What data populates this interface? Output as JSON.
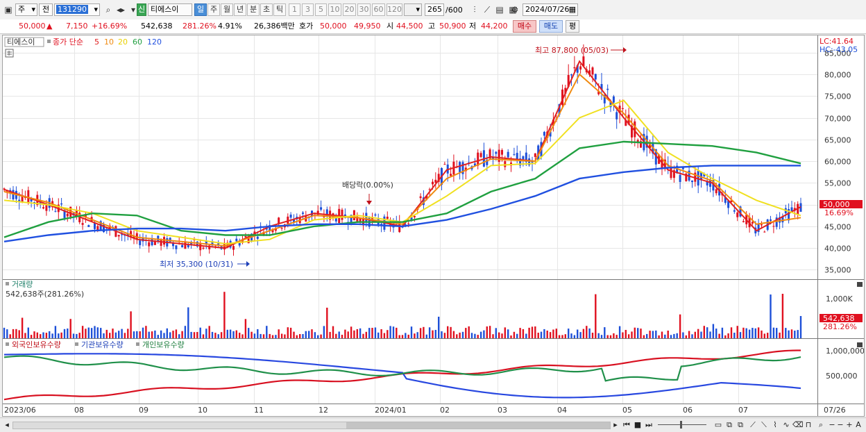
{
  "toolbar": {
    "interval_select": "주",
    "compare_label": "전",
    "stock_code": "131290",
    "badge": "신",
    "stock_name": "티에스이",
    "periods": [
      "일",
      "주",
      "월",
      "년",
      "분",
      "초",
      "틱"
    ],
    "selected_period": "일",
    "intervals": [
      "1",
      "3",
      "5",
      "10",
      "20",
      "30",
      "60",
      "120"
    ],
    "count": "265",
    "count_total": "/600",
    "date": "2024/07/26"
  },
  "quote": {
    "price": "50,000",
    "arrow": "▲",
    "change": "7,150",
    "change_pct": "+16.69%",
    "volume": "542,638",
    "volume_pct": "281.26%",
    "turnover": "4.91%",
    "amount": "26,386백만",
    "bid_label": "호가",
    "ask": "50,000",
    "bid": "49,950",
    "open_label": "시",
    "open": "44,500",
    "high_label": "고",
    "high": "50,900",
    "low_label": "저",
    "low": "44,200",
    "buy": "매수",
    "sell": "매도",
    "avg": "평"
  },
  "legend": {
    "name": "티에스이",
    "close_label": "종가 단순",
    "ma": [
      "5",
      "10",
      "20",
      "60",
      "120"
    ]
  },
  "annotations": {
    "high": "최고 87,800 (05/03)",
    "low": "최저 35,300 (10/31)",
    "dividend": "배당락(0.00%)",
    "lc": "LC:41.64",
    "hc": "HC:-43.05"
  },
  "price_axis": {
    "ticks": [
      "85,000",
      "80,000",
      "75,000",
      "70,000",
      "65,000",
      "60,000",
      "55,000",
      "50,000",
      "45,000",
      "40,000",
      "35,000"
    ],
    "current": "50,000",
    "current_pct": "16.69%"
  },
  "volume_panel": {
    "title": "거래량",
    "value": "542,638주(281.26%)",
    "tick": "1,000K",
    "current": "542,638",
    "current_pct": "281.26%"
  },
  "holdings_panel": {
    "foreign": "외국인보유수량",
    "inst": "기관보유수량",
    "indiv": "개인보유수량",
    "ticks": [
      "1,000,000",
      "500,000"
    ]
  },
  "date_axis": [
    "2023/06",
    "08",
    "09",
    "10",
    "11",
    "12",
    "2024/01",
    "02",
    "03",
    "04",
    "05",
    "06",
    "07",
    "07/26"
  ],
  "colors": {
    "up": "#e0101f",
    "down": "#1d4fd8",
    "ma5": "#e02020",
    "ma10": "#f08a10",
    "ma20": "#f0e020",
    "ma60": "#20a040",
    "ma120": "#2050e0"
  },
  "chart_data": {
    "type": "line",
    "price_range": [
      33000,
      88000
    ],
    "current_close": 50000,
    "high": {
      "value": 87800,
      "date": "05/03"
    },
    "low": {
      "value": 35300,
      "date": "10/31"
    },
    "x": [
      "2023/06",
      "08",
      "09",
      "10",
      "11",
      "12",
      "2024/01",
      "02",
      "03",
      "04",
      "05",
      "06",
      "07",
      "07/26"
    ],
    "series": [
      {
        "name": "5",
        "values": [
          53500,
          50000,
          46000,
          42000,
          41000,
          40000,
          45000,
          48000,
          47000,
          45000,
          58000,
          61000,
          60000,
          83000,
          70000,
          58000,
          55000,
          44000,
          49500
        ]
      },
      {
        "name": "10",
        "values": [
          53000,
          50500,
          46500,
          42500,
          41500,
          40500,
          44000,
          47500,
          47000,
          45500,
          56000,
          60500,
          60000,
          80000,
          71000,
          59000,
          55500,
          45500,
          47000
        ]
      },
      {
        "name": "20",
        "values": [
          51000,
          50000,
          48000,
          44000,
          42500,
          41000,
          42000,
          46500,
          47500,
          46000,
          52000,
          59000,
          59500,
          70000,
          74000,
          62000,
          56000,
          51000,
          47500
        ]
      },
      {
        "name": "60",
        "values": [
          42500,
          46000,
          48000,
          47500,
          44000,
          43000,
          43000,
          45000,
          46000,
          46000,
          48000,
          53000,
          56000,
          63000,
          64500,
          64000,
          63500,
          62000,
          59500
        ]
      },
      {
        "name": "120",
        "values": [
          41500,
          43000,
          44000,
          44500,
          44500,
          44000,
          45000,
          45500,
          45500,
          45000,
          46500,
          49000,
          52000,
          56000,
          57500,
          58500,
          59000,
          59000,
          59000
        ]
      }
    ]
  }
}
